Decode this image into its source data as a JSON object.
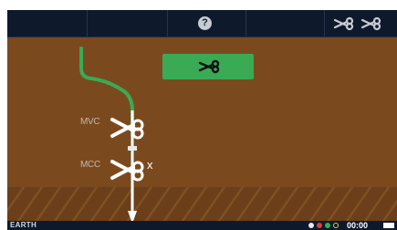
{
  "toolbar": {
    "help_icon": "question-circle-icon",
    "help_label": "?",
    "tool_icons": [
      "scissors-icon",
      "scissors-icon"
    ]
  },
  "game": {
    "cut_button_icon": "scissors-icon",
    "labels": {
      "upper": "MVC",
      "lower": "MCC",
      "mark": "x"
    }
  },
  "status": {
    "location": "EARTH",
    "time": "00:00",
    "indicators": [
      {
        "name": "globe-icon",
        "color": "#e8e8e8"
      },
      {
        "name": "red-status",
        "color": "#e23b3b"
      },
      {
        "name": "green-status",
        "color": "#2fb24a"
      },
      {
        "name": "yellow-status",
        "color": "#f2c53a"
      }
    ]
  },
  "colors": {
    "soil": "#7a4a1e",
    "bars": "#0e1a2c",
    "accent_green": "#3aaa55",
    "stem": "#ffffff"
  }
}
